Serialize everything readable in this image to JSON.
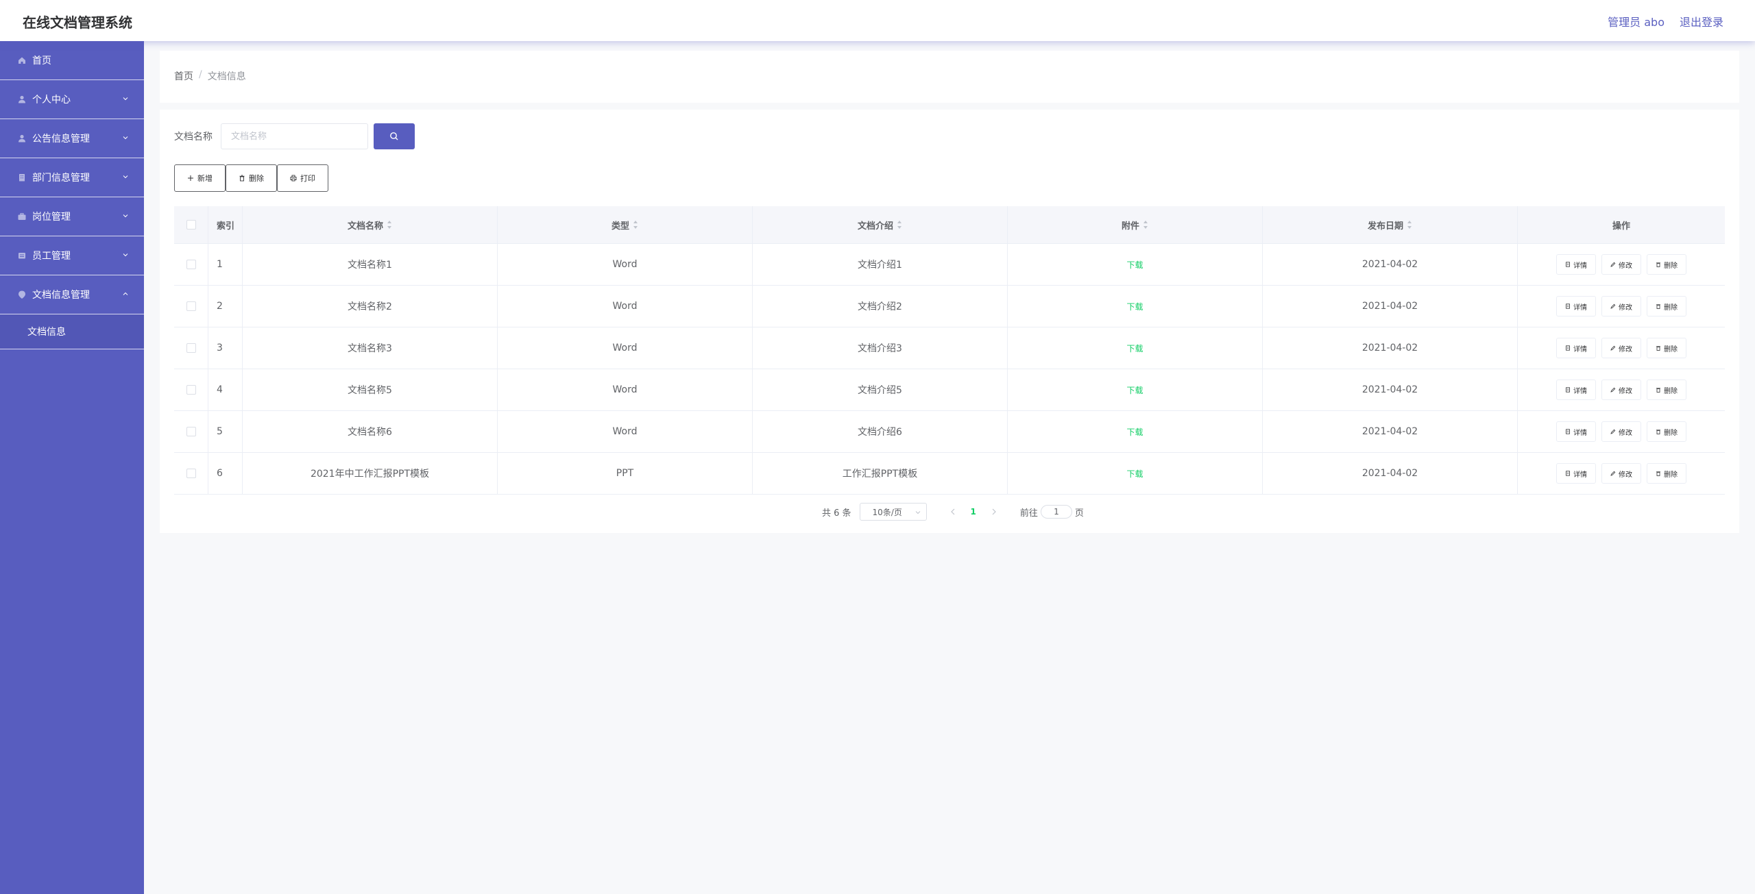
{
  "header": {
    "title": "在线文档管理系统",
    "user_label": "管理员 abo",
    "logout_label": "退出登录"
  },
  "sidebar": {
    "items": [
      {
        "label": "首页",
        "icon": "home-icon",
        "expandable": false
      },
      {
        "label": "个人中心",
        "icon": "user-icon",
        "expandable": true
      },
      {
        "label": "公告信息管理",
        "icon": "user-icon",
        "expandable": true
      },
      {
        "label": "部门信息管理",
        "icon": "building-icon",
        "expandable": true
      },
      {
        "label": "岗位管理",
        "icon": "briefcase-icon",
        "expandable": true
      },
      {
        "label": "员工管理",
        "icon": "id-card-icon",
        "expandable": true
      },
      {
        "label": "文档信息管理",
        "icon": "document-icon",
        "expandable": true,
        "expanded": true
      }
    ],
    "sub_items": [
      {
        "label": "文档信息"
      }
    ]
  },
  "breadcrumb": {
    "home": "首页",
    "separator": "/",
    "current": "文档信息"
  },
  "search": {
    "label": "文档名称",
    "placeholder": "文档名称"
  },
  "toolbar": {
    "add_label": "新增",
    "delete_label": "删除",
    "print_label": "打印"
  },
  "table": {
    "headers": {
      "index": "索引",
      "name": "文档名称",
      "type": "类型",
      "intro": "文档介绍",
      "attachment": "附件",
      "date": "发布日期",
      "ops": "操作"
    },
    "rows": [
      {
        "index": "1",
        "name": "文档名称1",
        "type": "Word",
        "intro": "文档介绍1",
        "attachment": "下载",
        "date": "2021-04-02"
      },
      {
        "index": "2",
        "name": "文档名称2",
        "type": "Word",
        "intro": "文档介绍2",
        "attachment": "下载",
        "date": "2021-04-02"
      },
      {
        "index": "3",
        "name": "文档名称3",
        "type": "Word",
        "intro": "文档介绍3",
        "attachment": "下载",
        "date": "2021-04-02"
      },
      {
        "index": "4",
        "name": "文档名称5",
        "type": "Word",
        "intro": "文档介绍5",
        "attachment": "下载",
        "date": "2021-04-02"
      },
      {
        "index": "5",
        "name": "文档名称6",
        "type": "Word",
        "intro": "文档介绍6",
        "attachment": "下载",
        "date": "2021-04-02"
      },
      {
        "index": "6",
        "name": "2021年中工作汇报PPT模板",
        "type": "PPT",
        "intro": "工作汇报PPT模板",
        "attachment": "下载",
        "date": "2021-04-02"
      }
    ],
    "row_ops": {
      "detail": "详情",
      "edit": "修改",
      "delete": "删除"
    }
  },
  "pagination": {
    "total": "共 6 条",
    "page_size": "10条/页",
    "current_page": "1",
    "goto_label": "前往",
    "goto_value": "1",
    "page_suffix": "页"
  },
  "colors": {
    "brand": "#585dbf",
    "link_green": "#13ce66"
  }
}
